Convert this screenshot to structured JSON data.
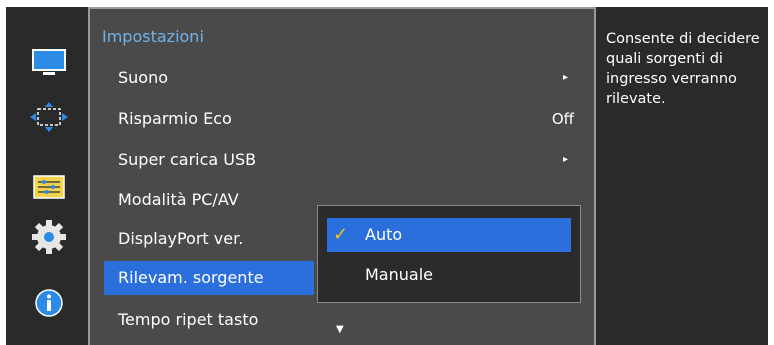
{
  "menu": {
    "title": "Impostazioni",
    "items": [
      {
        "label": "Suono",
        "value": "",
        "arrow": "▸"
      },
      {
        "label": "Risparmio Eco",
        "value": "Off",
        "arrow": ""
      },
      {
        "label": "Super carica USB",
        "value": "",
        "arrow": "▸"
      },
      {
        "label": "Modalità PC/AV",
        "value": "",
        "arrow": ""
      },
      {
        "label": "DisplayPort ver.",
        "value": "",
        "arrow": ""
      },
      {
        "label": "Rilevam. sorgente",
        "value": "",
        "arrow": ""
      },
      {
        "label": "Tempo ripet tasto",
        "value": "",
        "arrow": ""
      }
    ],
    "more_indicator": "▼"
  },
  "popup": {
    "options": [
      {
        "label": "Auto",
        "check": "✓"
      },
      {
        "label": "Manuale",
        "check": ""
      }
    ]
  },
  "help": {
    "text": "Consente di decidere quali sorgenti di ingresso verranno rilevate."
  },
  "icons": [
    "monitor-icon",
    "resize-arrows-icon",
    "equalizer-icon",
    "gear-icon",
    "info-icon"
  ],
  "colors": {
    "accent": "#2a6fdb",
    "title": "#6fb2ec",
    "check": "#f0c419"
  }
}
